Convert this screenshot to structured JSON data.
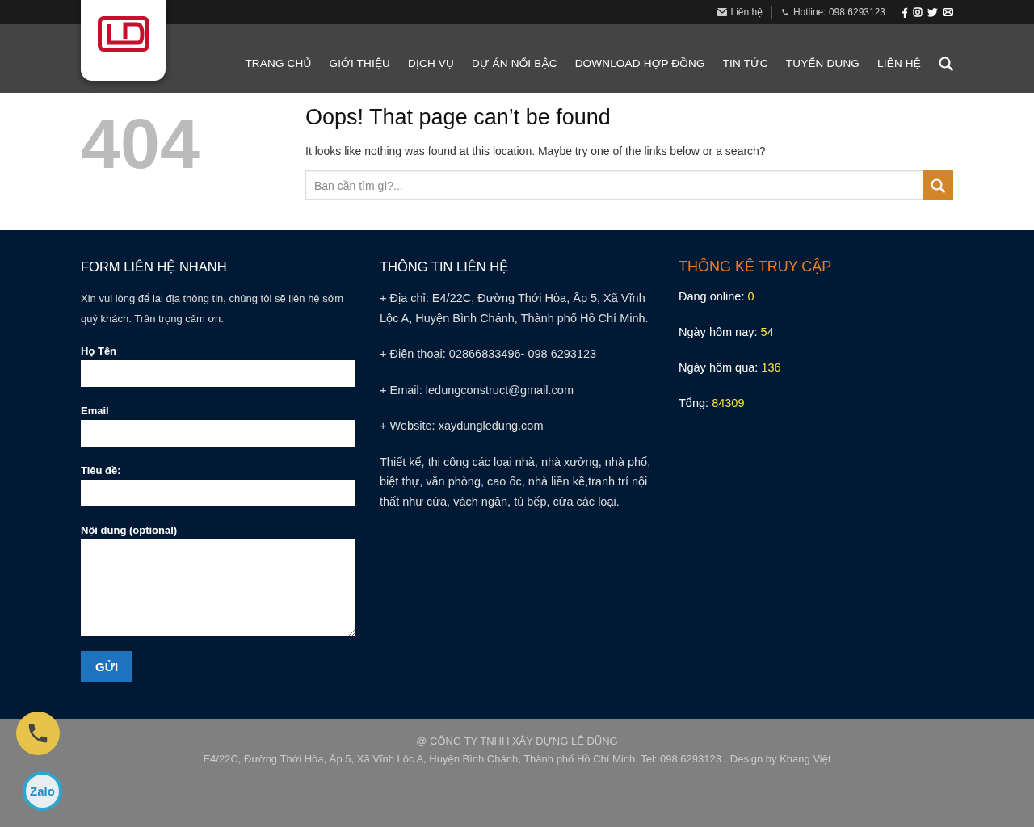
{
  "top_bar": {
    "links": [
      {
        "kind": "mail",
        "text": "Liên hệ"
      },
      {
        "kind": "phone",
        "text": "Hotline: 098 6293123"
      }
    ]
  },
  "nav": {
    "items": [
      {
        "label": "TRANG CHỦ"
      },
      {
        "label": "GIỚI THIỆU"
      },
      {
        "label": "DỊCH VỤ"
      },
      {
        "label": "DỰ ÁN NỔI BẬC"
      },
      {
        "label": "DOWNLOAD HỢP ĐỒNG"
      },
      {
        "label": "TIN TỨC"
      },
      {
        "label": "TUYỂN DỤNG"
      },
      {
        "label": "LIÊN HỆ"
      }
    ]
  },
  "error": {
    "code": "404",
    "title": "Oops! That page can’t be found",
    "message": "It looks like nothing was found at this location. Maybe try one of the links below or a search?",
    "search": {
      "placeholder": "Bạn cần tìm gì?..."
    }
  },
  "form_column": {
    "title": "FORM LIÊN HỆ NHANH",
    "intro": "Xin vui lòng để lại địa thông tin, chúng tôi sẽ liên hệ sớm quý khách. Trân trọng cảm ơn.",
    "fields": [
      {
        "label": "Họ Tên",
        "kind": "input"
      },
      {
        "label": "Email",
        "kind": "input"
      },
      {
        "label": "Tiêu đề:",
        "kind": "input"
      },
      {
        "label": "Nội dung (optional)",
        "kind": "textarea"
      }
    ],
    "submit": "GỬI"
  },
  "contact_column": {
    "title": "THÔNG TIN LIÊN HỆ",
    "lines": [
      "+ Địa chỉ: E4/22C, Đường Thới Hòa, Ấp 5, Xã Vĩnh Lộc A, Huyện Bình Chánh, Thành phố Hồ Chí Minh.",
      "+ Điện thoại: 02866833496- 098 6293123",
      "+ Email: ledungconstruct@gmail.com",
      "+ Website: xaydungledung.com",
      "Thiết kế, thi công các loại nhà, nhà xưởng, nhà phố, biệt thự, văn phòng, cao ốc, nhà liền kề,tranh trí nội thất như cửa, vách ngăn, tủ bếp, cửa các loại."
    ]
  },
  "stats_column": {
    "title": "THÔNG KÊ TRUY CẬP",
    "rows": [
      {
        "label": "Đang online:",
        "value": "0"
      },
      {
        "label": "Ngày hôm nay:",
        "value": "54"
      },
      {
        "label": "Ngày hôm qua:",
        "value": "136"
      },
      {
        "label": "Tổng:",
        "value": "84309"
      }
    ]
  },
  "bottom_bar": {
    "company": "@ CÔNG TY TNHH XÂY DỰNG LÊ DŨNG",
    "address": "E4/22C, Đường Thới Hòa, Ấp 5, Xã Vĩnh Lộc A, Huyện Bình Chánh, Thành phố Hồ Chí Minh. Tel: 098 6293123 . Design by Khang Việt"
  },
  "floating": {
    "zalo": "Zalo"
  }
}
